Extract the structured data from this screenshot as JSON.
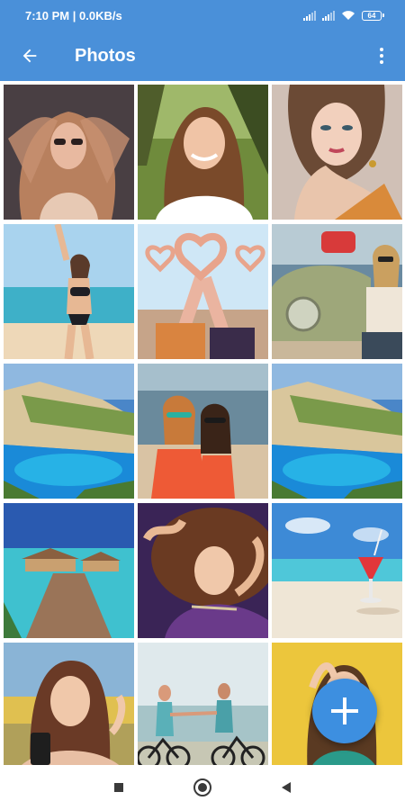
{
  "status_bar": {
    "time_speed": "7:10 PM | 0.0KB/s",
    "battery_level": "64",
    "icons": [
      "signal-icon",
      "signal-icon",
      "wifi-icon",
      "battery-icon"
    ]
  },
  "app_bar": {
    "title": "Photos",
    "back_icon": "arrow-back-icon",
    "menu_icon": "more-vert-icon"
  },
  "gallery": {
    "photos": [
      {
        "name": "photo-woman-long-hair-sunglasses"
      },
      {
        "name": "photo-woman-smiling-outdoors"
      },
      {
        "name": "photo-woman-portrait-pose"
      },
      {
        "name": "photo-woman-bikini-beach"
      },
      {
        "name": "photo-friends-heart-hands"
      },
      {
        "name": "photo-woman-vintage-car"
      },
      {
        "name": "photo-island-cove"
      },
      {
        "name": "photo-two-women-beach"
      },
      {
        "name": "photo-island-cove-copy"
      },
      {
        "name": "photo-overwater-pier"
      },
      {
        "name": "photo-woman-lying-hair"
      },
      {
        "name": "photo-beach-drink"
      },
      {
        "name": "photo-woman-phone"
      },
      {
        "name": "photo-couple-bicycles"
      },
      {
        "name": "photo-woman-yellow-wall"
      }
    ]
  },
  "fab": {
    "icon": "plus-icon"
  },
  "nav_bar": {
    "icons": [
      "recents-square-icon",
      "home-circle-icon",
      "back-triangle-icon"
    ]
  }
}
